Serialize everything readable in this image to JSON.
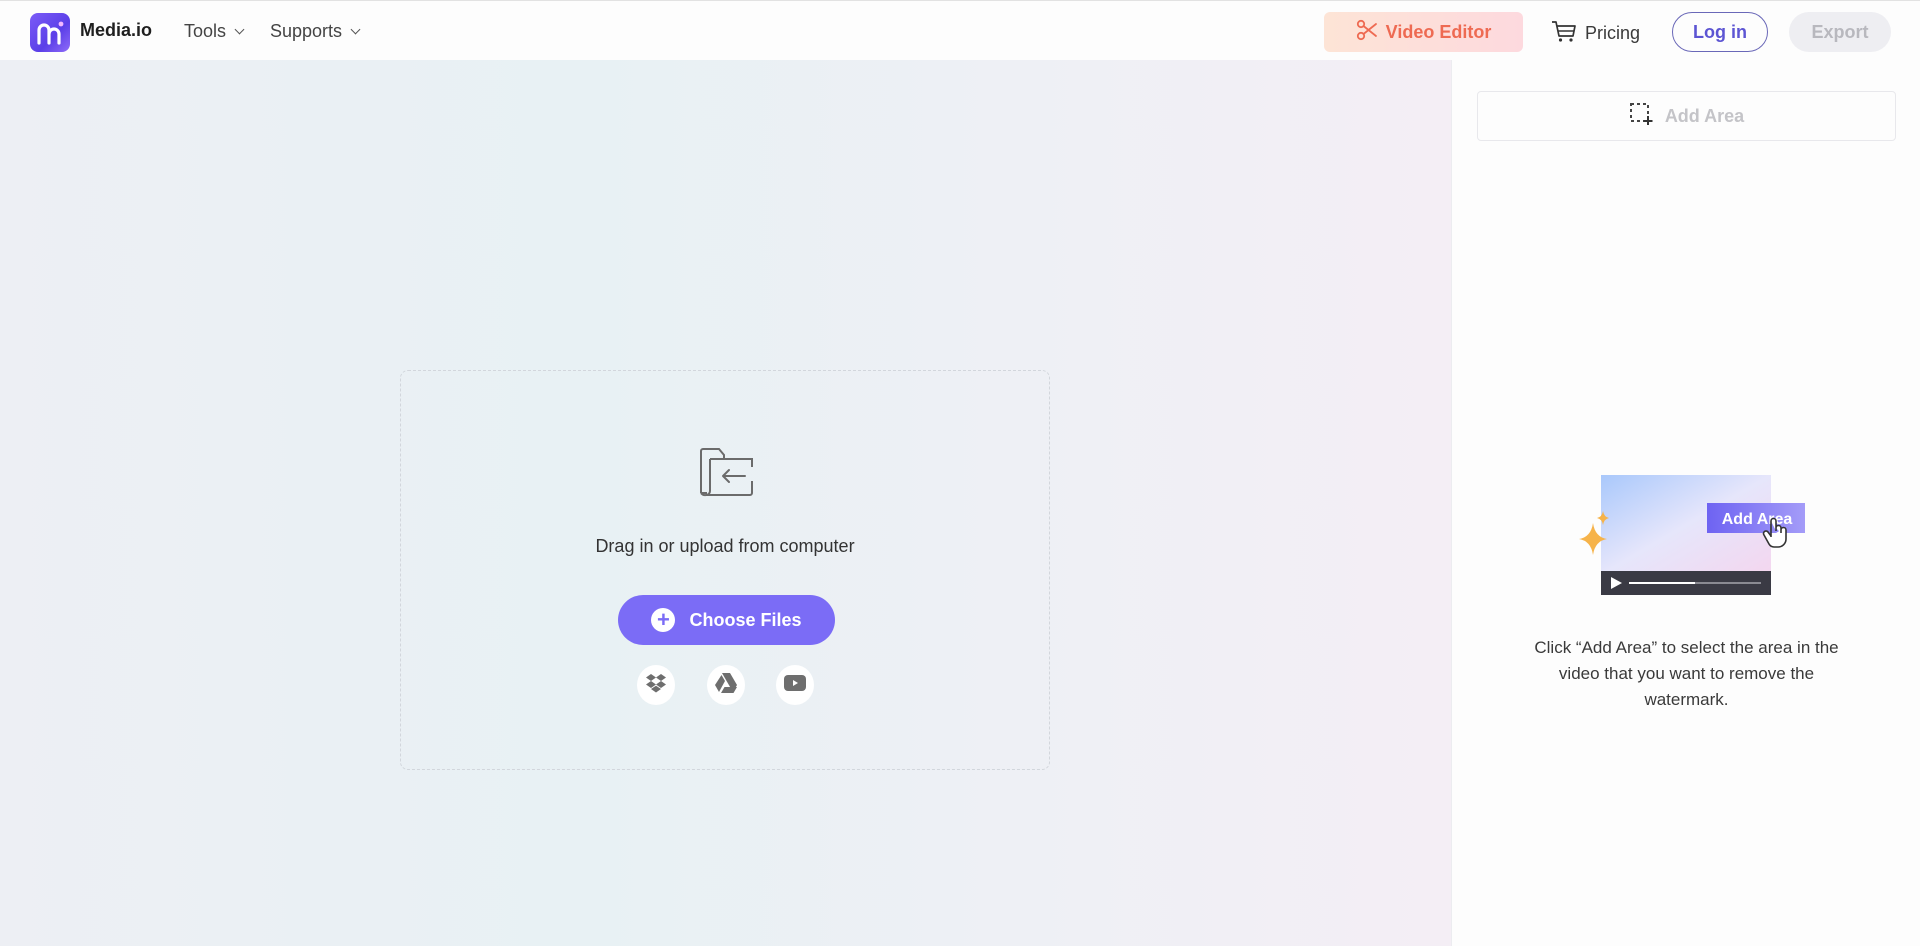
{
  "header": {
    "logo_text": "Media.io",
    "nav": [
      {
        "label": "Tools"
      },
      {
        "label": "Supports"
      }
    ],
    "video_editor_label": "Video Editor",
    "pricing_label": "Pricing",
    "login_label": "Log in",
    "export_label": "Export"
  },
  "upload": {
    "drop_text": "Drag in or upload from computer",
    "choose_files_label": "Choose Files",
    "sources": [
      {
        "icon": "dropbox-icon"
      },
      {
        "icon": "google-drive-icon"
      },
      {
        "icon": "youtube-icon"
      }
    ]
  },
  "sidebar": {
    "add_area_label": "Add Area",
    "illustration_label": "Add Area",
    "illustration_progress": 0.5,
    "hint": "Click “Add Area” to select the area in the video that you want to remove the watermark."
  },
  "colors": {
    "brand": "#7b6cf6",
    "video_editor_text": "#ee6a52",
    "login_text": "#5d55d3"
  }
}
